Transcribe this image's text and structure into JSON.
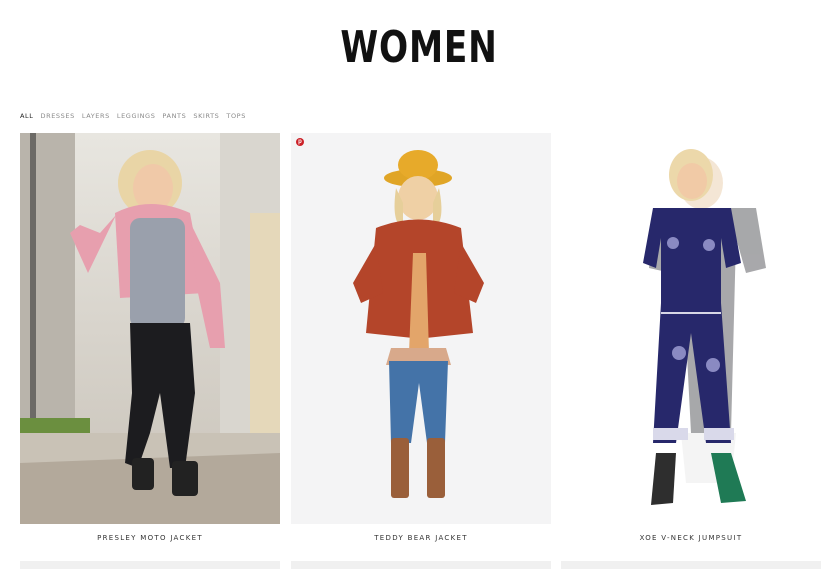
{
  "page": {
    "title": "WOMEN"
  },
  "filters": [
    {
      "label": "All",
      "active": true
    },
    {
      "label": "DRESSES"
    },
    {
      "label": "LAYERS"
    },
    {
      "label": "LEGGINGS"
    },
    {
      "label": "PANTS"
    },
    {
      "label": "SKIRTS"
    },
    {
      "label": "TOPS"
    }
  ],
  "products": [
    {
      "name": "PRESLEY MOTO JACKET",
      "image": "woman-pink-moto-jacket-photo"
    },
    {
      "name": "TEDDY BEAR JACKET",
      "image": "woman-rust-teddy-jacket-photo"
    },
    {
      "name": "XOE V-NECK JUMPSUIT",
      "image": "woman-navy-jumpsuit-photo"
    }
  ],
  "pinterest_badge": {
    "glyph": "p",
    "icon": "pinterest-icon",
    "color": "#cb2027"
  }
}
